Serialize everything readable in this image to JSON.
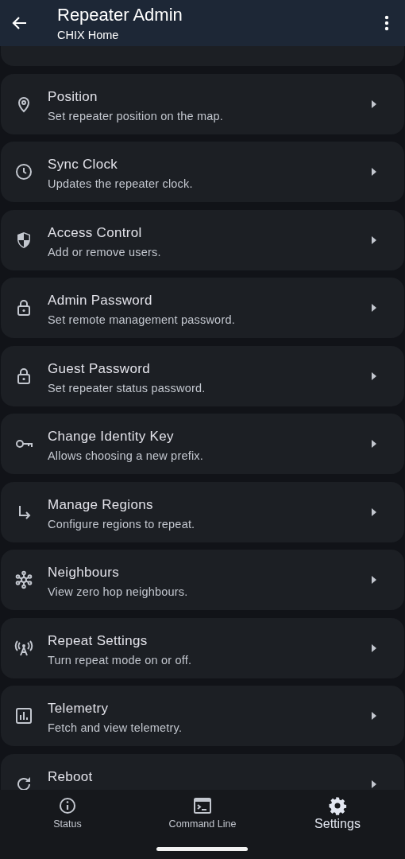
{
  "app_bar": {
    "title": "Repeater Admin",
    "subtitle": "CHIX Home"
  },
  "settings": [
    {
      "title": "Position",
      "subtitle": "Set repeater position on the map."
    },
    {
      "title": "Sync Clock",
      "subtitle": "Updates the repeater clock."
    },
    {
      "title": "Access Control",
      "subtitle": "Add or remove users."
    },
    {
      "title": "Admin Password",
      "subtitle": "Set remote management password."
    },
    {
      "title": "Guest Password",
      "subtitle": "Set repeater status password."
    },
    {
      "title": "Change Identity Key",
      "subtitle": "Allows choosing a new prefix."
    },
    {
      "title": "Manage Regions",
      "subtitle": "Configure regions to repeat."
    },
    {
      "title": "Neighbours",
      "subtitle": "View zero hop neighbours."
    },
    {
      "title": "Repeat Settings",
      "subtitle": "Turn repeat mode on or off."
    },
    {
      "title": "Telemetry",
      "subtitle": "Fetch and view telemetry."
    },
    {
      "title": "Reboot"
    }
  ],
  "bottom_nav": [
    {
      "label": "Status",
      "selected": false
    },
    {
      "label": "Command Line",
      "selected": false
    },
    {
      "label": "Settings",
      "selected": true
    }
  ]
}
